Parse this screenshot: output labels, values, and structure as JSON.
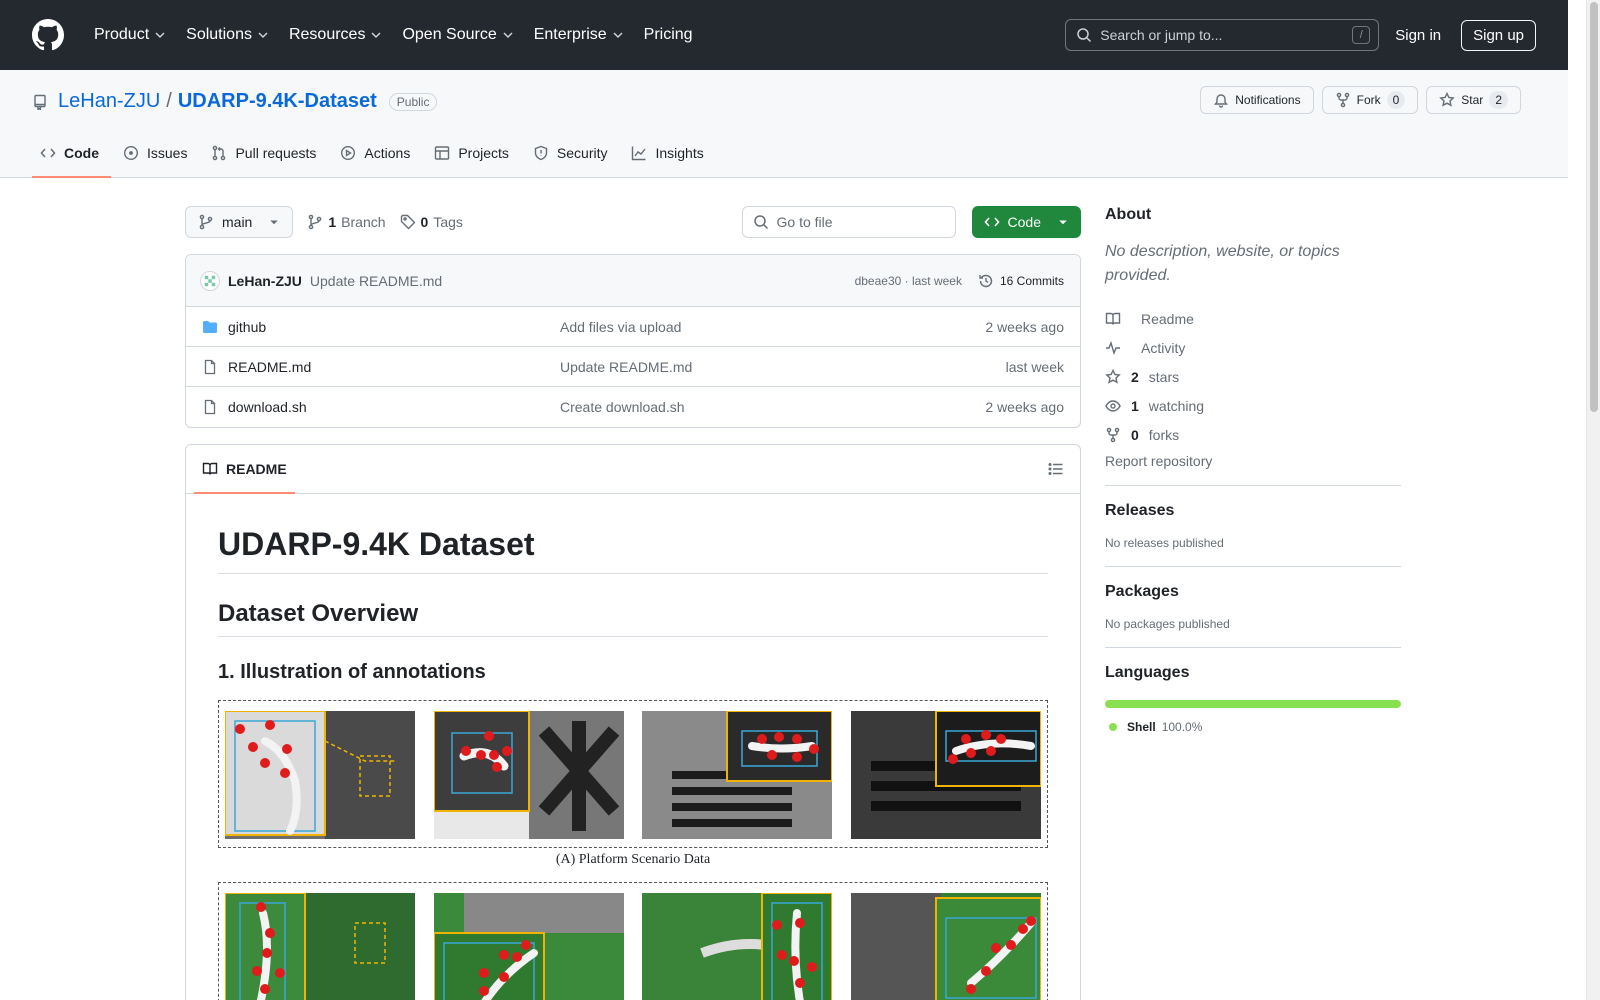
{
  "header": {
    "nav": [
      {
        "label": "Product",
        "has_menu": true
      },
      {
        "label": "Solutions",
        "has_menu": true
      },
      {
        "label": "Resources",
        "has_menu": true
      },
      {
        "label": "Open Source",
        "has_menu": true
      },
      {
        "label": "Enterprise",
        "has_menu": true
      },
      {
        "label": "Pricing",
        "has_menu": false
      }
    ],
    "search_placeholder": "Search or jump to...",
    "search_shortcut": "/",
    "sign_in": "Sign in",
    "sign_up": "Sign up"
  },
  "repo": {
    "owner": "LeHan-ZJU",
    "separator": "/",
    "name": "UDARP-9.4K-Dataset",
    "visibility": "Public",
    "notifications_label": "Notifications",
    "fork_label": "Fork",
    "fork_count": "0",
    "star_label": "Star",
    "star_count": "2",
    "tabs": [
      {
        "label": "Code",
        "icon": "code-icon",
        "active": true
      },
      {
        "label": "Issues",
        "icon": "issue-icon",
        "active": false
      },
      {
        "label": "Pull requests",
        "icon": "pull-request-icon",
        "active": false
      },
      {
        "label": "Actions",
        "icon": "play-icon",
        "active": false
      },
      {
        "label": "Projects",
        "icon": "table-icon",
        "active": false
      },
      {
        "label": "Security",
        "icon": "shield-icon",
        "active": false
      },
      {
        "label": "Insights",
        "icon": "graph-icon",
        "active": false
      }
    ]
  },
  "toolbar": {
    "branch": "main",
    "branch_count": "1",
    "branch_label": "Branch",
    "tag_count": "0",
    "tag_label": "Tags",
    "go_to_file": "Go to file",
    "code_button": "Code"
  },
  "latest_commit": {
    "author": "LeHan-ZJU",
    "message": "Update README.md",
    "hash_time": "dbeae30 · last week",
    "commits_label": "16 Commits"
  },
  "files": [
    {
      "name": "github",
      "type": "folder",
      "commit": "Add files via upload",
      "time": "2 weeks ago"
    },
    {
      "name": "README.md",
      "type": "file",
      "commit": "Update README.md",
      "time": "last week"
    },
    {
      "name": "download.sh",
      "type": "file",
      "commit": "Create download.sh",
      "time": "2 weeks ago"
    }
  ],
  "readme": {
    "tab_label": "README",
    "title": "UDARP-9.4K Dataset",
    "overview": "Dataset Overview",
    "section1": "1. Illustration of annotations",
    "caption_a": "(A) Platform Scenario Data"
  },
  "sidebar": {
    "about_title": "About",
    "about_desc": "No description, website, or topics provided.",
    "items": [
      {
        "icon": "book-icon",
        "count": "",
        "label": "Readme"
      },
      {
        "icon": "pulse-icon",
        "count": "",
        "label": "Activity"
      },
      {
        "icon": "star-icon",
        "count": "2",
        "label": "stars"
      },
      {
        "icon": "eye-icon",
        "count": "1",
        "label": "watching"
      },
      {
        "icon": "fork-icon",
        "count": "0",
        "label": "forks"
      }
    ],
    "report": "Report repository",
    "releases_title": "Releases",
    "releases_text": "No releases published",
    "packages_title": "Packages",
    "packages_text": "No packages published",
    "languages_title": "Languages",
    "languages": [
      {
        "name": "Shell",
        "percent": "100.0%",
        "color": "#89e051"
      }
    ]
  },
  "colors": {
    "header_bg": "#24292f",
    "link": "#0969da",
    "code_button": "#1f883d",
    "active_tab_underline": "#fd8c73"
  }
}
